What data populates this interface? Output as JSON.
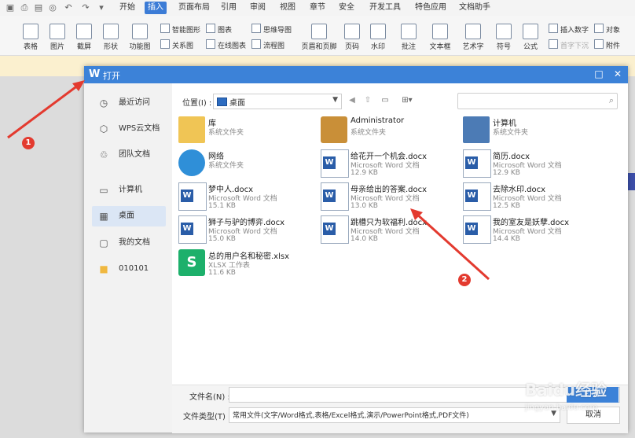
{
  "ribbon": {
    "menus": [
      "开始",
      "插入",
      "页面布局",
      "引用",
      "审阅",
      "视图",
      "章节",
      "安全",
      "开发工具",
      "特色应用",
      "文档助手"
    ],
    "active_menu": "插入",
    "buttons": [
      "表格",
      "图片",
      "截屏",
      "形状",
      "功能图",
      "图表",
      "在线图表",
      "页眉和页脚",
      "页码",
      "水印",
      "批注",
      "文本框",
      "艺术字",
      "符号",
      "公式"
    ],
    "small_buttons": [
      "智能图形",
      "关系图",
      "思维导图",
      "流程图",
      "插入数字",
      "对象",
      "首字下沉",
      "附件"
    ]
  },
  "dialog": {
    "title": "打开",
    "sidebar": [
      {
        "label": "最近访问",
        "icon": "clock-icon"
      },
      {
        "label": "WPS云文档",
        "icon": "cube-icon"
      },
      {
        "label": "团队文档",
        "icon": "team-icon"
      },
      {
        "label": "计算机",
        "icon": "monitor-icon"
      },
      {
        "label": "桌面",
        "icon": "desktop-icon"
      },
      {
        "label": "我的文档",
        "icon": "person-folder-icon"
      },
      {
        "label": "010101",
        "icon": "folder-icon"
      }
    ],
    "active_sidebar": "桌面",
    "location_label": "位置(I) :",
    "location_value": "桌面",
    "search_placeholder": "",
    "files": [
      {
        "name": "库",
        "type": "系统文件夹",
        "size": "",
        "icon": "library-folder-icon"
      },
      {
        "name": "Administrator",
        "type": "系统文件夹",
        "size": "",
        "icon": "user-folder-icon"
      },
      {
        "name": "计算机",
        "type": "系统文件夹",
        "size": "",
        "icon": "computer-icon"
      },
      {
        "name": "网络",
        "type": "系统文件夹",
        "size": "",
        "icon": "network-globe-icon"
      },
      {
        "name": "给花开一个机会.docx",
        "type": "Microsoft Word 文档",
        "size": "12.9 KB",
        "icon": "word-doc-icon"
      },
      {
        "name": "简历.docx",
        "type": "Microsoft Word 文档",
        "size": "12.9 KB",
        "icon": "word-doc-icon"
      },
      {
        "name": "梦中人.docx",
        "type": "Microsoft Word 文档",
        "size": "15.1 KB",
        "icon": "word-doc-icon"
      },
      {
        "name": "母亲给出的答案.docx",
        "type": "Microsoft Word 文档",
        "size": "13.0 KB",
        "icon": "word-doc-icon"
      },
      {
        "name": "去除水印.docx",
        "type": "Microsoft Word 文档",
        "size": "12.5 KB",
        "icon": "word-doc-icon"
      },
      {
        "name": "狮子与驴的博弈.docx",
        "type": "Microsoft Word 文档",
        "size": "15.0 KB",
        "icon": "word-doc-icon"
      },
      {
        "name": "跳槽只为软福利.docx",
        "type": "Microsoft Word 文档",
        "size": "14.0 KB",
        "icon": "word-doc-icon"
      },
      {
        "name": "我的室友是妖孽.docx",
        "type": "Microsoft Word 文档",
        "size": "14.4 KB",
        "icon": "word-doc-icon"
      },
      {
        "name": "总的用户名和秘密.xlsx",
        "type": "XLSX 工作表",
        "size": "11.6 KB",
        "icon": "excel-doc-icon"
      }
    ],
    "filename_label": "文件名(N) :",
    "filename_value": "",
    "filetype_label": "文件类型(T) :",
    "filetype_value": "常用文件(文字/Word格式,表格/Excel格式,演示/PowerPoint格式,PDF文件)",
    "open_button": "打开",
    "cancel_button": "取消"
  },
  "annotations": [
    "1",
    "2"
  ],
  "watermark": {
    "main": "Baidu经验",
    "sub": "jingyan.baidu.com"
  },
  "colors": {
    "accent": "#3c82d8",
    "marker": "#e33a2f",
    "highlight": "#fbf0cf"
  }
}
